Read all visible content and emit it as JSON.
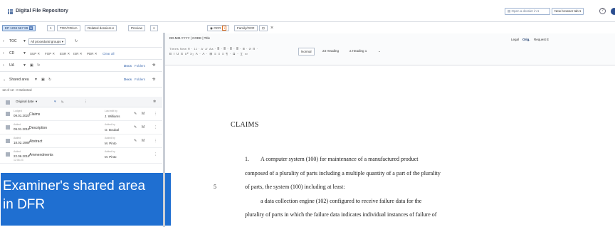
{
  "app": {
    "title": "Digital File Repository"
  },
  "topbar": {
    "open_dossier": "Open a dossier in",
    "new_tab": "New browser tab",
    "help": "?"
  },
  "left_toolbar": {
    "dossier_id": "EP 1234 567 89",
    "dossier_badge": "B",
    "count": "1",
    "toc_cd_ua": "TOC/CD/UA",
    "related": "Related dossiers",
    "preview": "Preview",
    "calendar": "≡"
  },
  "doc_tabs": {
    "ocr": "OCR",
    "ocr_badge": "1",
    "family_ocr": "Family/OCR",
    "dup": "⊡",
    "close": "×"
  },
  "left_panel": {
    "toc": {
      "label": "TOC",
      "select": "All procedural groups"
    },
    "cd": {
      "label": "CD",
      "tags": [
        "SUP ✕",
        "FOP ✕",
        "ESR ✕",
        "ISR ✕",
        "PDR ✕"
      ],
      "clear": "Clear all"
    },
    "ua": {
      "label": "UA",
      "docs": "Docs",
      "folders": "Folders"
    },
    "shared": {
      "label": "Shared area",
      "docs": "Docs",
      "folders": "Folders"
    },
    "selection_count": "12 of 12 - 0 Selected",
    "sort_select": "Original date",
    "rows": [
      {
        "d1": "Lodged",
        "date": "09.01.2020",
        "title": "Claims",
        "a1": "Last edit by",
        "author": "J. Williams"
      },
      {
        "d1": "Added",
        "date": "09.01.2019",
        "title": "Description",
        "a1": "Added by",
        "author": "O. Boubal"
      },
      {
        "d1": "Added",
        "date": "18.02.1989",
        "title": "Abstract",
        "a1": "Added by",
        "author": "M. Pinto"
      },
      {
        "d1": "Added",
        "date": "22.06.2018",
        "d3": "12:06:23",
        "title": "Ammendments",
        "a1": "Added by",
        "author": "M. Pinto"
      }
    ]
  },
  "overlay": {
    "line1": "Examiner's shared area",
    "line2": "in DFR"
  },
  "doc_toolbar": {
    "doc_id": "DD.MM.YYYY | CODE | Title",
    "legal": "Legal",
    "orig": "Orig.",
    "request": "Request E",
    "fmt_row1": "Times New R · 11 · A' A' Aa ·   ≣ · ≣ · ≣ · ≣ · ⊞ ·   ⊘ ⊟ ·",
    "fmt_row2": "B I U S x² x₂ A · A ·   ⊞ ≡ ≡ ≡ ¶ · Ω ·   ∑ ▭",
    "style_normal": "Normal",
    "style_h2": "23 Heading",
    "style_h1": "a Heading 1",
    "style_more": "⌄"
  },
  "document": {
    "heading": "CLAIMS",
    "claim_no": "1.",
    "line1": "A computer system (100) for maintenance of a manufactured product",
    "line2": "composed of a plurality of parts including a multiple quantity of a part of the plurality",
    "line3": "of parts, the system (100) including at least:",
    "line4": "a data collection engine (102) configured to receive failure data for the",
    "line5": "plurality of parts in which the failure data indicates individual instances of failure of",
    "line_number": "5"
  }
}
